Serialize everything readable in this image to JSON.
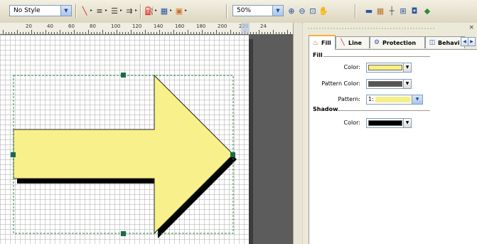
{
  "toolbar": {
    "style_value": "No Style",
    "zoom_value": "50%",
    "icons": [
      "line-color-icon",
      "line-weight-icon",
      "line-pattern-icon",
      "line-ends-icon",
      "fill-color-icon",
      "fill-pattern-icon",
      "shadow-icon",
      "zoom-in-icon",
      "zoom-out-icon",
      "zoom-page-icon",
      "pan-hand-icon",
      "view-ruler-icon",
      "grid-icon",
      "guides-icon",
      "connection-points-icon",
      "snap-icon",
      "color-icon"
    ]
  },
  "ruler": {
    "labels": [
      "20",
      "40",
      "60",
      "80",
      "100",
      "120",
      "140",
      "160",
      "180",
      "200",
      "220",
      "24"
    ]
  },
  "panel": {
    "tabs": [
      {
        "label": "Fill",
        "icon": "fill-bucket-icon"
      },
      {
        "label": "Line",
        "icon": "line-icon"
      },
      {
        "label": "Protection",
        "icon": "protection-icon"
      },
      {
        "label": "Behavi",
        "icon": "behavior-icon"
      }
    ],
    "fill_group": "Fill",
    "shadow_group": "Shadow",
    "fill_color_label": "Color:",
    "pattern_color_label": "Pattern Color:",
    "pattern_label": "Pattern:",
    "pattern_value": "1:",
    "shadow_color_label": "Color:"
  },
  "colors": {
    "fill_color": "#f6ef82",
    "pattern_color": "#555555",
    "shadow_color": "#000000",
    "shape_fill": "#f8f08a",
    "selection_handle": "#1a6b4a"
  }
}
